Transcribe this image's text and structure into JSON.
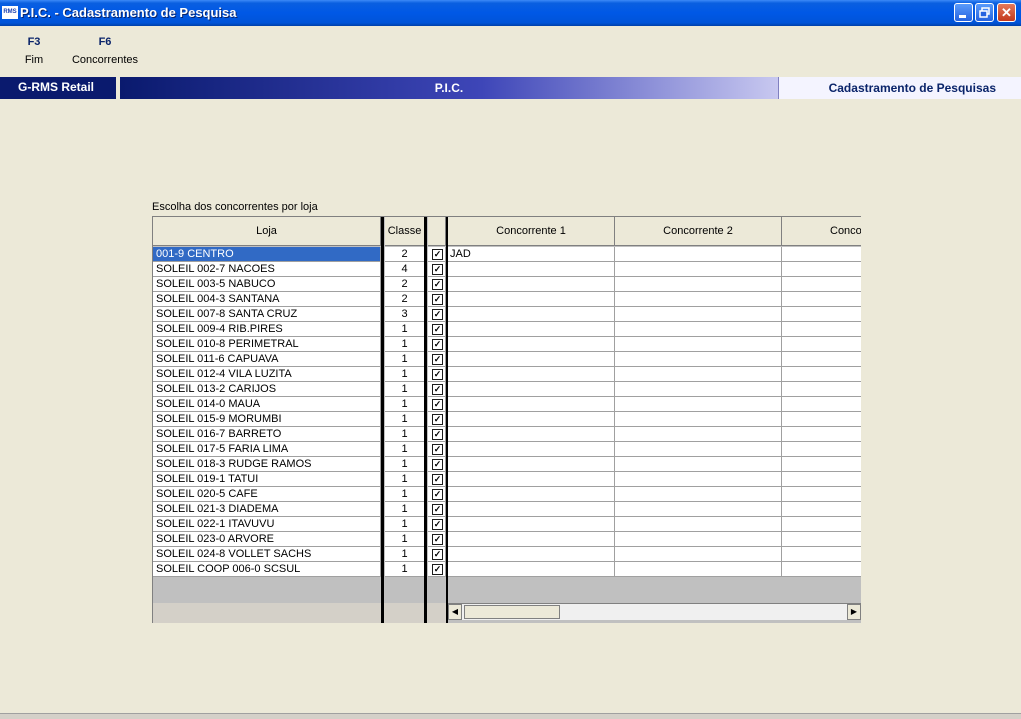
{
  "window": {
    "icon_text": "RMS",
    "title": "P.I.C. - Cadastramento de Pesquisa"
  },
  "function_keys": [
    {
      "key": "F3",
      "label": "Fim"
    },
    {
      "key": "F6",
      "label": "Concorrentes"
    }
  ],
  "banner": {
    "left": "G-RMS Retail",
    "center": "P.I.C.",
    "right": "Cadastramento de Pesquisas"
  },
  "grid": {
    "caption": "Escolha dos concorrentes por loja",
    "headers": {
      "loja": "Loja",
      "classe": "Classe",
      "concorrente1": "Concorrente 1",
      "concorrente2": "Concorrente 2",
      "concorrente3": "Conco"
    },
    "rows": [
      {
        "loja": "001-9 CENTRO",
        "classe": "2",
        "checked": true,
        "c1": "JAD"
      },
      {
        "loja": "SOLEIL 002-7 NACOES",
        "classe": "4",
        "checked": true,
        "c1": ""
      },
      {
        "loja": "SOLEIL 003-5 NABUCO",
        "classe": "2",
        "checked": true,
        "c1": ""
      },
      {
        "loja": "SOLEIL 004-3 SANTANA",
        "classe": "2",
        "checked": true,
        "c1": ""
      },
      {
        "loja": "SOLEIL 007-8 SANTA CRUZ",
        "classe": "3",
        "checked": true,
        "c1": ""
      },
      {
        "loja": "SOLEIL 009-4 RIB.PIRES",
        "classe": "1",
        "checked": true,
        "c1": ""
      },
      {
        "loja": "SOLEIL 010-8 PERIMETRAL",
        "classe": "1",
        "checked": true,
        "c1": ""
      },
      {
        "loja": "SOLEIL 011-6 CAPUAVA",
        "classe": "1",
        "checked": true,
        "c1": ""
      },
      {
        "loja": "SOLEIL 012-4 VILA LUZITA",
        "classe": "1",
        "checked": true,
        "c1": ""
      },
      {
        "loja": "SOLEIL 013-2 CARIJOS",
        "classe": "1",
        "checked": true,
        "c1": ""
      },
      {
        "loja": "SOLEIL 014-0 MAUA",
        "classe": "1",
        "checked": true,
        "c1": ""
      },
      {
        "loja": "SOLEIL 015-9 MORUMBI",
        "classe": "1",
        "checked": true,
        "c1": ""
      },
      {
        "loja": "SOLEIL 016-7 BARRETO",
        "classe": "1",
        "checked": true,
        "c1": ""
      },
      {
        "loja": "SOLEIL 017-5 FARIA LIMA",
        "classe": "1",
        "checked": true,
        "c1": ""
      },
      {
        "loja": "SOLEIL 018-3 RUDGE RAMOS",
        "classe": "1",
        "checked": true,
        "c1": ""
      },
      {
        "loja": "SOLEIL 019-1 TATUI",
        "classe": "1",
        "checked": true,
        "c1": ""
      },
      {
        "loja": "SOLEIL 020-5 CAFE",
        "classe": "1",
        "checked": true,
        "c1": ""
      },
      {
        "loja": "SOLEIL 021-3 DIADEMA",
        "classe": "1",
        "checked": true,
        "c1": ""
      },
      {
        "loja": "SOLEIL 022-1 ITAVUVU",
        "classe": "1",
        "checked": true,
        "c1": ""
      },
      {
        "loja": "SOLEIL 023-0  ARVORE",
        "classe": "1",
        "checked": true,
        "c1": ""
      },
      {
        "loja": "SOLEIL 024-8 VOLLET SACHS",
        "classe": "1",
        "checked": true,
        "c1": ""
      },
      {
        "loja": "SOLEIL COOP 006-0 SCSUL",
        "classe": "1",
        "checked": true,
        "c1": ""
      }
    ],
    "selected_row": 0
  },
  "colors": {
    "selection": "#316AC5",
    "banner_dark": "#0a1a6e"
  }
}
